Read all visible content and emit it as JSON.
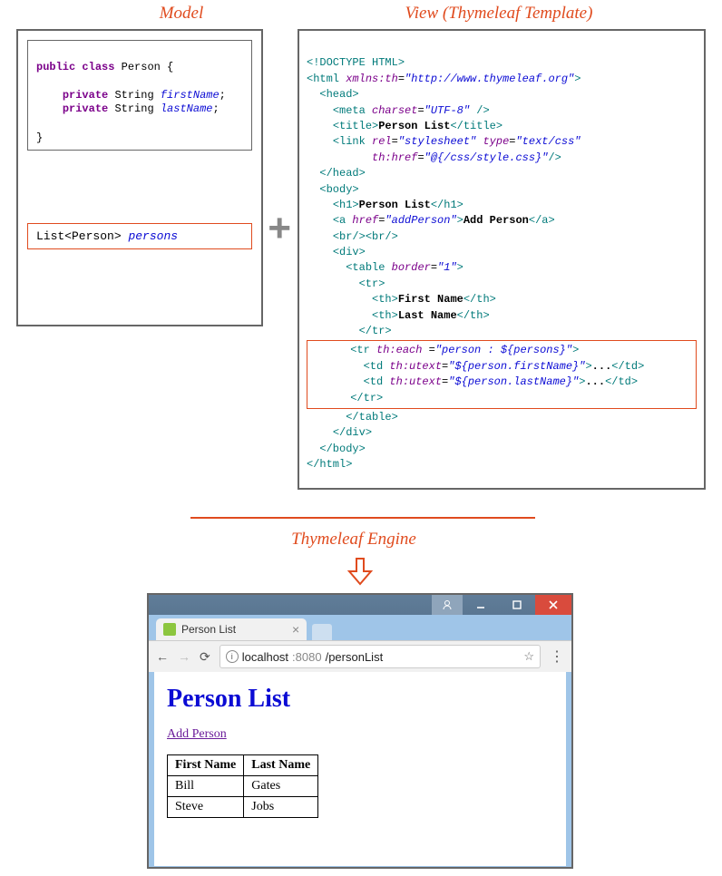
{
  "titles": {
    "model": "Model",
    "view": "View (Thymeleaf Template)",
    "engine": "Thymeleaf Engine"
  },
  "model_code": {
    "line1_kw1": "public",
    "line1_kw2": "class",
    "line1_name": "Person {",
    "line2_kw": "private",
    "line2_type": "String",
    "line2_var": "firstName",
    "line3_kw": "private",
    "line3_type": "String",
    "line3_var": "lastName",
    "close": "}"
  },
  "list_decl": {
    "type": "List<Person>",
    "var": "persons"
  },
  "template_code": {
    "l1": "<!DOCTYPE HTML>",
    "l2_open": "<html ",
    "l2_attr": "xmlns:th",
    "l2_eq": "=",
    "l2_val": "\"http://www.thymeleaf.org\"",
    "l2_close": ">",
    "head_open": "<head>",
    "meta_open": "<meta ",
    "meta_attr": "charset",
    "meta_val": "\"UTF-8\"",
    "meta_close": " />",
    "title_open": "<title>",
    "title_text": "Person List",
    "title_close": "</title>",
    "link_open": "<link ",
    "link_rel_attr": "rel",
    "link_rel_val": "\"stylesheet\"",
    "link_type_attr": "type",
    "link_type_val": "\"text/css\"",
    "link_href_attr": "th:href",
    "link_href_val": "\"@{/css/style.css}\"",
    "link_close": "/>",
    "head_close": "</head>",
    "body_open": "<body>",
    "h1_open": "<h1>",
    "h1_text": "Person List",
    "h1_close": "</h1>",
    "a_open": "<a ",
    "a_href_attr": "href",
    "a_href_val": "\"addPerson\"",
    "a_mid": ">",
    "a_text": "Add Person",
    "a_close": "</a>",
    "br": "<br/><br/>",
    "div_open": "<div>",
    "table_open": "<table ",
    "table_border_attr": "border",
    "table_border_val": "\"1\"",
    "table_mid": ">",
    "tr_open": "<tr>",
    "th1_open": "<th>",
    "th1_text": "First Name",
    "th1_close": "</th>",
    "th2_open": "<th>",
    "th2_text": "Last Name",
    "th2_close": "</th>",
    "tr_close": "</tr>",
    "tr2_open": "<tr ",
    "tr2_attr": "th:each ",
    "tr2_eq": "=",
    "tr2_val": "\"person : ${persons}\"",
    "tr2_mid": ">",
    "td1_open": "<td ",
    "td1_attr": "th:utext",
    "td1_val": "\"${person.firstName}\"",
    "td1_mid": ">",
    "td1_text": "...",
    "td1_close": "</td>",
    "td2_open": "<td ",
    "td2_attr": "th:utext",
    "td2_val": "\"${person.lastName}\"",
    "td2_mid": ">",
    "td2_text": "...",
    "td2_close": "</td>",
    "tr2_close": "</tr>",
    "table_close": "</table>",
    "div_close": "</div>",
    "body_close": "</body>",
    "html_close": "</html>"
  },
  "browser": {
    "tab_title": "Person List",
    "url_host": "localhost",
    "url_port": ":8080",
    "url_path": "/personList",
    "page_h1": "Person List",
    "add_link": "Add Person",
    "col1": "First Name",
    "col2": "Last Name",
    "rows": [
      {
        "first": "Bill",
        "last": "Gates"
      },
      {
        "first": "Steve",
        "last": "Jobs"
      }
    ]
  }
}
